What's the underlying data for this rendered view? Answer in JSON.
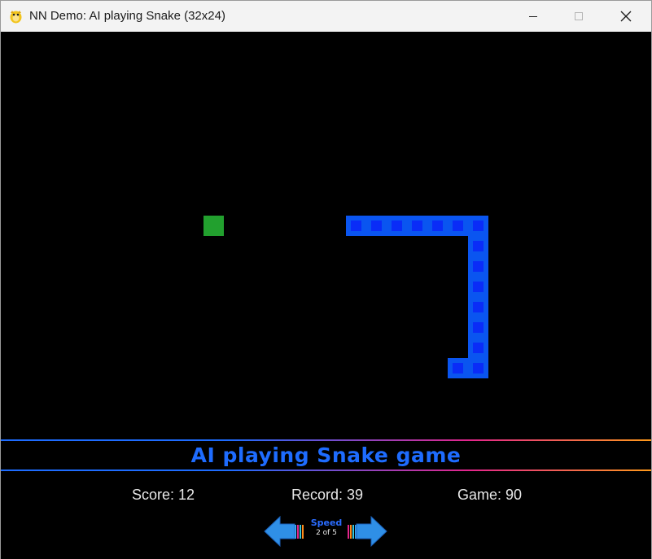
{
  "window": {
    "title": "NN Demo: AI playing Snake (32x24)",
    "icon": "pygame-snake-icon",
    "controls": [
      "minimize-icon",
      "maximize-icon",
      "close-icon"
    ]
  },
  "game": {
    "grid_cols": 32,
    "grid_rows": 24,
    "food": {
      "col": 10,
      "row": 9
    },
    "snake": [
      {
        "col": 17,
        "row": 9
      },
      {
        "col": 18,
        "row": 9
      },
      {
        "col": 19,
        "row": 9
      },
      {
        "col": 20,
        "row": 9
      },
      {
        "col": 21,
        "row": 9
      },
      {
        "col": 22,
        "row": 9
      },
      {
        "col": 23,
        "row": 9
      },
      {
        "col": 23,
        "row": 10
      },
      {
        "col": 23,
        "row": 11
      },
      {
        "col": 23,
        "row": 12
      },
      {
        "col": 23,
        "row": 13
      },
      {
        "col": 23,
        "row": 14
      },
      {
        "col": 23,
        "row": 15
      },
      {
        "col": 23,
        "row": 16
      },
      {
        "col": 22,
        "row": 16
      }
    ]
  },
  "banner": {
    "title": "AI playing Snake game"
  },
  "stats": {
    "score": "Score: 12",
    "record": "Record: 39",
    "game": "Game: 90"
  },
  "speed": {
    "label": "Speed",
    "value": "2 of 5"
  },
  "colors": {
    "background": "#000000",
    "snake_outer": "#0a55f0",
    "snake_inner": "#0a2cf7",
    "food": "#22a02e",
    "banner_gradient": [
      "#1e6cff",
      "#e3258c",
      "#ff9a1a"
    ],
    "arrow": "#2f8fe6"
  }
}
